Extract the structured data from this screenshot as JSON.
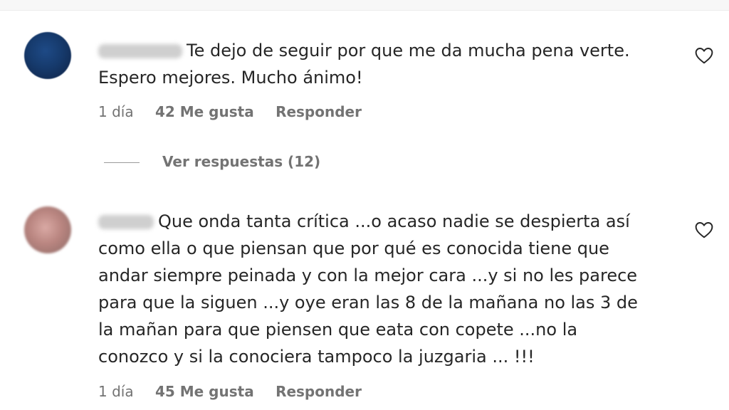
{
  "comments": [
    {
      "text_line1": "Te dejo de seguir por que me da mucha pena verte.",
      "text_line2": "Espero mejores. Mucho ánimo!",
      "time": "1 día",
      "likes": "42 Me gusta",
      "reply": "Responder",
      "view_replies": "Ver respuestas (12)"
    },
    {
      "lines": [
        "Que onda tanta crítica ...o acaso nadie se despierta así",
        "como ella o que piensan que por qué es conocida tiene que",
        "andar siempre peinada y con la mejor cara ...y si no les parece",
        "para que la siguen ...y oye eran las 8 de la mañana no las 3 de",
        "la mañan para que piensen que eata con copete ...no la",
        "conozco y si la conociera tampoco la juzgaria ... !!!"
      ],
      "time": "1 día",
      "likes": "45 Me gusta",
      "reply": "Responder"
    }
  ],
  "icons": {
    "like": "heart-icon"
  }
}
